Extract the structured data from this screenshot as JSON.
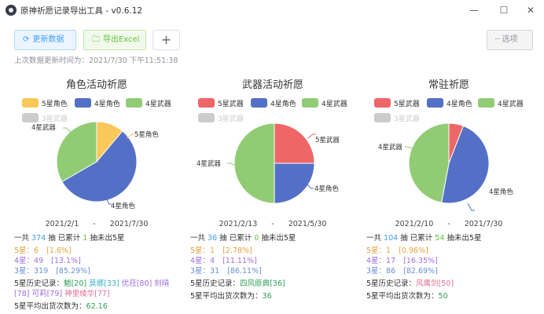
{
  "window": {
    "title": "原神祈愿记录导出工具 - v0.6.12"
  },
  "window_controls": {
    "minimize": "—",
    "maximize": "☐",
    "close": "✕"
  },
  "toolbar": {
    "refresh_label": "更新数据",
    "export_label": "导出Excel",
    "add_label": "+",
    "options_label": "选项"
  },
  "last_update": "上次数据更新时间为：2021/7/30 下午11:51:38",
  "colors": {
    "star5": "#fac858",
    "char4": "#5470c6",
    "weapon4": "#91cc75",
    "weapon3": "#cccccc",
    "red5": "#ee6666"
  },
  "panels": [
    {
      "title": "角色活动祈愿",
      "legend": {
        "l1": "5星角色",
        "l2": "4星角色",
        "l3": "4星武器",
        "l4": "3星武器"
      },
      "labels": {
        "a": "5星角色",
        "b": "4星角色",
        "c": "4星武器"
      },
      "date_from": "2021/2/1",
      "date_sep": "-",
      "date_to": "2021/7/30",
      "summary": {
        "p1": "一共",
        "total": "374",
        "p2": "抽 已累计",
        "since": "1",
        "p3": "抽未出5星"
      },
      "rows": {
        "r5": {
          "label": "5星：",
          "count": "6",
          "pct": "[1.6%]"
        },
        "r4": {
          "label": "4星：",
          "count": "49",
          "pct": "[13.1%]"
        },
        "r3": {
          "label": "3星：",
          "count": "319",
          "pct": "[85.29%]"
        }
      },
      "history_label": "5星历史记录：",
      "history": [
        {
          "name": "魈",
          "pulls": "[20]"
        },
        {
          "name": "莫娜",
          "pulls": "[33]"
        },
        {
          "name": "优菈",
          "pulls": "[80]"
        },
        {
          "name": "刻晴",
          "pulls": "[78]"
        },
        {
          "name": "可莉",
          "pulls": "[79]"
        },
        {
          "name": "神里绫华",
          "pulls": "[77]"
        }
      ],
      "avg_label": "5星平均出货次数为：",
      "avg": "62.16"
    },
    {
      "title": "武器活动祈愿",
      "legend": {
        "l1": "5星武器",
        "l2": "4星角色",
        "l3": "4星武器",
        "l4": "3星武器"
      },
      "labels": {
        "a": "5星武器",
        "b": "4星角色",
        "c": "4星武器"
      },
      "date_from": "2021/2/13",
      "date_sep": "-",
      "date_to": "2021/5/30",
      "summary": {
        "p1": "一共",
        "total": "36",
        "p2": "抽 已累计",
        "since": "0",
        "p3": "抽未出5星"
      },
      "rows": {
        "r5": {
          "label": "5星：",
          "count": "1",
          "pct": "[2.78%]"
        },
        "r4": {
          "label": "4星：",
          "count": "4",
          "pct": "[11.11%]"
        },
        "r3": {
          "label": "3星：",
          "count": "31",
          "pct": "[86.11%]"
        }
      },
      "history_label": "5星历史记录：",
      "history": [
        {
          "name": "四风原典",
          "pulls": "[36]"
        }
      ],
      "avg_label": "5星平均出货次数为：",
      "avg": "36"
    },
    {
      "title": "常驻祈愿",
      "legend": {
        "l1": "5星武器",
        "l2": "4星角色",
        "l3": "4星武器",
        "l4": "3星武器"
      },
      "labels": {
        "a": "",
        "b": "4星角色",
        "c": "4星武器"
      },
      "date_from": "2021/2/10",
      "date_sep": "-",
      "date_to": "2021/7/30",
      "summary": {
        "p1": "一共",
        "total": "104",
        "p2": "抽 已累计",
        "since": "54",
        "p3": "抽未出5星"
      },
      "rows": {
        "r5": {
          "label": "5星：",
          "count": "1",
          "pct": "[0.96%]"
        },
        "r4": {
          "label": "4星：",
          "count": "17",
          "pct": "[16.35%]"
        },
        "r3": {
          "label": "3星：",
          "count": "86",
          "pct": "[82.69%]"
        }
      },
      "history_label": "5星历史记录：",
      "history": [
        {
          "name": "风鹰剑",
          "pulls": "[50]"
        }
      ],
      "avg_label": "5星平均出货次数为：",
      "avg": "50"
    }
  ],
  "chart_data": [
    {
      "type": "pie",
      "title": "角色活动祈愿",
      "categories": [
        "5星角色",
        "4星角色",
        "4星武器"
      ],
      "values": [
        1,
        5,
        3
      ],
      "colors": [
        "#fac858",
        "#5470c6",
        "#91cc75"
      ]
    },
    {
      "type": "pie",
      "title": "武器活动祈愿",
      "categories": [
        "5星武器",
        "4星角色",
        "4星武器"
      ],
      "values": [
        1,
        1,
        2
      ],
      "colors": [
        "#ee6666",
        "#5470c6",
        "#91cc75"
      ]
    },
    {
      "type": "pie",
      "title": "常驻祈愿",
      "categories": [
        "5星武器",
        "4星角色",
        "4星武器"
      ],
      "values": [
        1,
        8,
        8
      ],
      "colors": [
        "#ee6666",
        "#5470c6",
        "#91cc75"
      ]
    }
  ]
}
